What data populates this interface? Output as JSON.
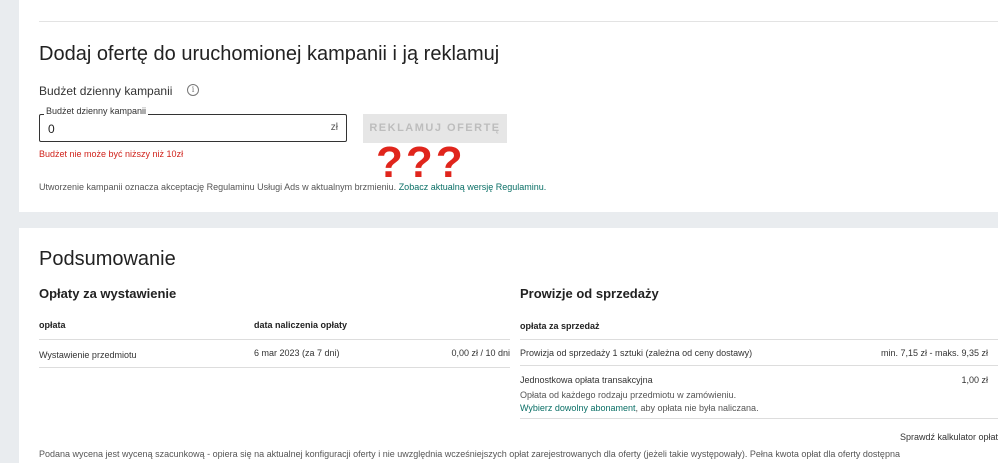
{
  "campaign": {
    "title": "Dodaj ofertę do uruchomionej kampanii i ją reklamuj",
    "budget_label": "Budżet dzienny kampanii",
    "info_icon": "info-icon",
    "field_legend": "Budżet dzienny kampanii",
    "field_value": "0",
    "field_unit": "zł",
    "submit_label": "REKLAMUJ OFERTĘ",
    "error": "Budżet nie może być niższy niż 10zł",
    "terms_text": "Utworzenie kampanii oznacza akceptację Regulaminu Usługi Ads w aktualnym brzmieniu.",
    "terms_link": "Zobacz aktualną wersję Regulaminu.",
    "annotation": "???"
  },
  "summary": {
    "title": "Podsumowanie",
    "listing": {
      "heading": "Opłaty za wystawienie",
      "col_fee": "opłata",
      "col_date": "data naliczenia opłaty",
      "row_name": "Wystawienie przedmiotu",
      "row_date": "6 mar 2023 (za 7 dni)",
      "row_amount": "0,00 zł / 10 dni"
    },
    "sales": {
      "heading": "Prowizje od sprzedaży",
      "col_fee": "opłata za sprzedaż",
      "row1_name": "Prowizja od sprzedaży 1 sztuki (zależna od ceny dostawy)",
      "row1_amount": "min. 7,15 zł - maks. 9,35 zł",
      "row2_name": "Jednostkowa opłata transakcyjna",
      "row2_amount": "1,00 zł",
      "row2_desc": "Opłata od każdego rodzaju przedmiotu w zamówieniu.",
      "row2_link": "Wybierz dowolny abonament",
      "row2_link_suffix": ", aby opłata nie była naliczana.",
      "calculator_link": "Sprawdź kalkulator opłat"
    },
    "footnote": "Podana wycena jest wyceną szacunkową - opiera się na aktualnej konfiguracji oferty i nie uwzględnia wcześniejszych opłat zarejestrowanych dla oferty (jeżeli takie występowały). Pełna kwota opłat dla oferty dostępna"
  },
  "colors": {
    "background": "#e9ecef",
    "error": "#d0221b",
    "link": "#0a6f66",
    "annotation": "#e0251c",
    "button_disabled": "#e6e6e6"
  }
}
